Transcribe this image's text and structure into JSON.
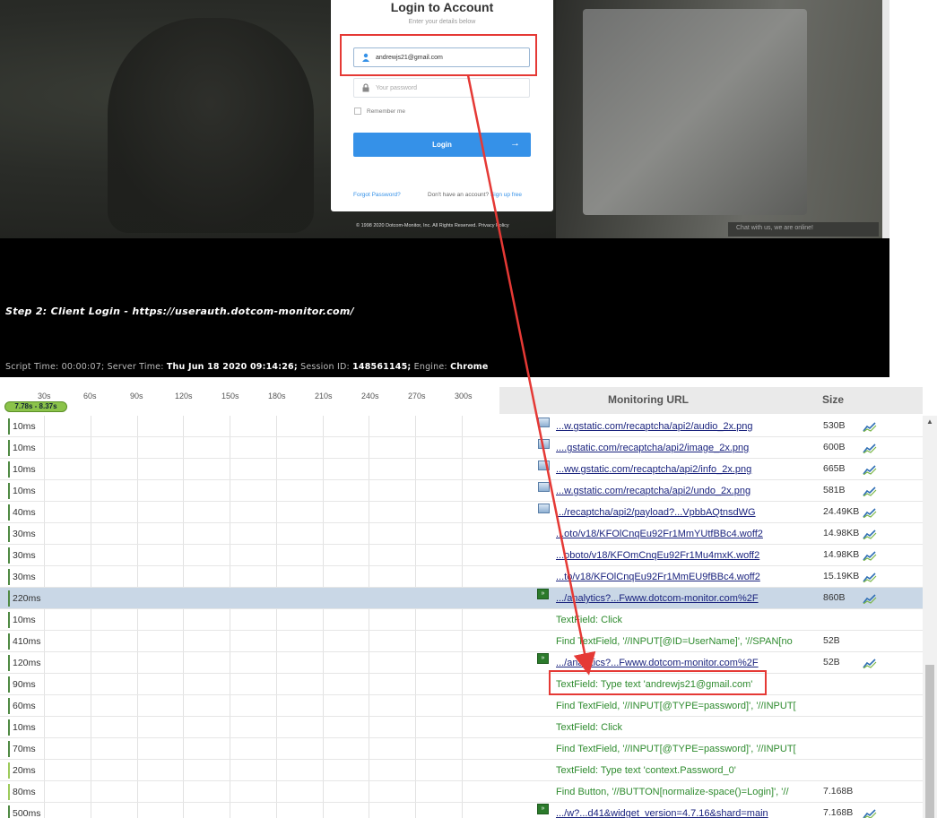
{
  "login": {
    "title": "Login to Account",
    "subtitle": "Enter your details below",
    "email_value": "andrewjs21@gmail.com",
    "password_placeholder": "Your password",
    "remember_label": "Remember me",
    "button_label": "Login",
    "forgot_label": "Forgot Password?",
    "no_account_label": "Don't have an account?",
    "signup_label": "Sign up free",
    "copyright": "© 1998 2020 Dotcom-Monitor, Inc. All Rights Reserved. Privacy Policy",
    "chat_label": "Chat with us, we are online!"
  },
  "step": {
    "title": "Step 2: Client Login - https://userauth.dotcom-monitor.com/",
    "script_time_label": "Script Time:",
    "script_time": "00:00:07;",
    "server_time_label": "Server Time:",
    "server_time": "Thu Jun 18 2020 09:14:26;",
    "session_label": "Session ID:",
    "session_id": "148561145;",
    "engine_label": "Engine:",
    "engine": "Chrome"
  },
  "waterfall": {
    "range_badge": "7.78s - 8.37s",
    "ticks": [
      "30s",
      "60s",
      "90s",
      "120s",
      "150s",
      "180s",
      "210s",
      "240s",
      "270s",
      "300s"
    ],
    "header_url": "Monitoring URL",
    "header_size": "Size",
    "rows": [
      {
        "dur": "10ms",
        "kind": "img",
        "text": "...w.gstatic.com/recaptcha/api2/audio_2x.png",
        "size": "530B",
        "chart": true
      },
      {
        "dur": "10ms",
        "kind": "img",
        "text": "....gstatic.com/recaptcha/api2/image_2x.png",
        "size": "600B",
        "chart": true
      },
      {
        "dur": "10ms",
        "kind": "img",
        "text": "...ww.gstatic.com/recaptcha/api2/info_2x.png",
        "size": "665B",
        "chart": true
      },
      {
        "dur": "10ms",
        "kind": "img",
        "text": "...w.gstatic.com/recaptcha/api2/undo_2x.png",
        "size": "581B",
        "chart": true
      },
      {
        "dur": "40ms",
        "kind": "img",
        "text": ".../recaptcha/api2/payload?...VpbbAQtnsdWG",
        "size": "24.49KB",
        "chart": true
      },
      {
        "dur": "30ms",
        "kind": "none",
        "text": "...oto/v18/KFOlCnqEu92Fr1MmYUtfBBc4.woff2",
        "size": "14.98KB",
        "chart": true
      },
      {
        "dur": "30ms",
        "kind": "none",
        "text": "...oboto/v18/KFOmCnqEu92Fr1Mu4mxK.woff2",
        "size": "14.98KB",
        "chart": true
      },
      {
        "dur": "30ms",
        "kind": "none",
        "text": "...to/v18/KFOlCnqEu92Fr1MmEU9fBBc4.woff2",
        "size": "15.19KB",
        "chart": true
      },
      {
        "dur": "220ms",
        "kind": "js",
        "text": ".../analytics?...Fwww.dotcom-monitor.com%2F",
        "size": "860B",
        "chart": true,
        "selected": true
      },
      {
        "dur": "10ms",
        "kind": "action",
        "text": "TextField: Click",
        "size": "",
        "chart": false
      },
      {
        "dur": "410ms",
        "kind": "action",
        "text": "Find TextField, '//INPUT[@ID=UserName]', '//SPAN[no",
        "size": "52B",
        "chart": false
      },
      {
        "dur": "120ms",
        "kind": "js",
        "text": ".../analytics?...Fwww.dotcom-monitor.com%2F",
        "size": "52B",
        "chart": true
      },
      {
        "dur": "90ms",
        "kind": "action",
        "text": "TextField: Type text 'andrewjs21@gmail.com'",
        "size": "",
        "chart": false
      },
      {
        "dur": "60ms",
        "kind": "action",
        "text": "Find TextField, '//INPUT[@TYPE=password]', '//INPUT[",
        "size": "",
        "chart": false
      },
      {
        "dur": "10ms",
        "kind": "action",
        "text": "TextField: Click",
        "size": "",
        "chart": false
      },
      {
        "dur": "70ms",
        "kind": "action",
        "text": "Find TextField, '//INPUT[@TYPE=password]', '//INPUT[",
        "size": "",
        "chart": false
      },
      {
        "dur": "20ms",
        "kind": "action",
        "text": "TextField: Type text 'context.Password_0'",
        "size": "",
        "chart": false
      },
      {
        "dur": "80ms",
        "kind": "action",
        "text": "Find Button, '//BUTTON[normalize-space()=Login]', '//",
        "size": "7.168B",
        "chart": false
      },
      {
        "dur": "500ms",
        "kind": "js",
        "text": ".../w?...d41&widget_version=4.7.16&shard=main",
        "size": "7.168B",
        "chart": true
      }
    ]
  },
  "colors": {
    "accent_blue": "#3591e8",
    "highlight_red": "#e53935",
    "action_green": "#2e8b2e",
    "link_navy": "#1a237e",
    "selected_row": "#c9d7e6"
  }
}
